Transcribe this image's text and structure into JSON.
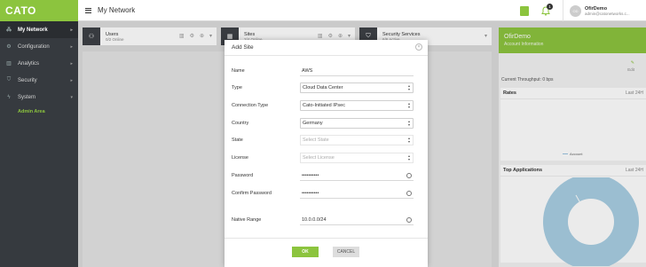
{
  "app": {
    "logo": "CATO",
    "page_title": "My Network"
  },
  "sidebar": {
    "items": [
      {
        "label": "My Network",
        "icon": "network-icon"
      },
      {
        "label": "Configuration",
        "icon": "gear-icon"
      },
      {
        "label": "Analytics",
        "icon": "chart-icon"
      },
      {
        "label": "Security",
        "icon": "shield-icon"
      },
      {
        "label": "System",
        "icon": "bolt-icon"
      }
    ],
    "sub_item": "Admin Area"
  },
  "header": {
    "notification_count": "1",
    "user_name": "OfirDemo",
    "user_email": "admin@catonetworks.c..."
  },
  "cards": [
    {
      "title": "Users",
      "subtitle": "0/2 Online"
    },
    {
      "title": "Sites",
      "subtitle": "2/4 Online"
    },
    {
      "title": "Security Services",
      "subtitle": "6/6 Active"
    }
  ],
  "account_panel": {
    "title": "OfirDemo",
    "subtitle": "Account Information",
    "edit_label": "Edit",
    "throughput_label": "Current Throughput:",
    "throughput_value": "0 bps",
    "rates_title": "Rates",
    "rates_range": "Last 24H",
    "rates_legend": "Account",
    "top_apps_title": "Top Applications",
    "top_apps_range": "Last 24H"
  },
  "modal": {
    "title": "Add Site",
    "fields": {
      "name_label": "Name",
      "name_value": "AWS",
      "type_label": "Type",
      "type_value": "Cloud Data Center",
      "conn_label": "Connection Type",
      "conn_value": "Cato-Initiated IPsec",
      "country_label": "Country",
      "country_value": "Germany",
      "state_label": "State",
      "state_value": "Select State",
      "license_label": "License",
      "license_value": "Select License",
      "password_label": "Password",
      "password_value": "••••••••••",
      "confirm_label": "Confirm Password",
      "confirm_value": "••••••••••",
      "range_label": "Native Range",
      "range_value": "10.0.0.0/24"
    },
    "ok_label": "OK",
    "cancel_label": "CANCEL"
  },
  "colors": {
    "brand": "#8cc43e",
    "sidebar": "#363a3f",
    "donut": "#a9cfe3"
  }
}
